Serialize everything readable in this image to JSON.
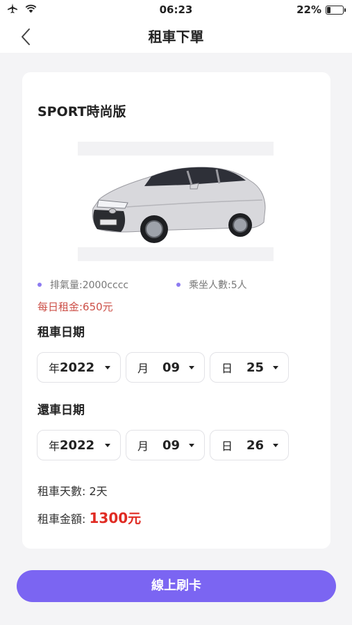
{
  "status_bar": {
    "time": "06:23",
    "battery_percent": "22%",
    "battery_level": 0.22
  },
  "nav": {
    "title": "租車下單"
  },
  "car": {
    "model": "SPORT時尚版",
    "displacement": "排氣量:2000cccc",
    "seats": "乘坐人數:5人",
    "daily_rent": "每日租金:650元"
  },
  "rental_date": {
    "label": "租車日期",
    "year_unit": "年",
    "year": "2022",
    "month_unit": "月",
    "month": "09",
    "day_unit": "日",
    "day": "25"
  },
  "return_date": {
    "label": "還車日期",
    "year_unit": "年",
    "year": "2022",
    "month_unit": "月",
    "month": "09",
    "day_unit": "日",
    "day": "26"
  },
  "summary": {
    "days_label": "租車天數:",
    "days_value": "2天",
    "amount_label": "租車金額:",
    "amount_value": "1300",
    "amount_unit": "元"
  },
  "actions": {
    "pay_label": "線上刷卡"
  },
  "colors": {
    "accent": "#7b65f2",
    "price_red": "#e02b23",
    "daily_rent": "#cc4f47"
  }
}
